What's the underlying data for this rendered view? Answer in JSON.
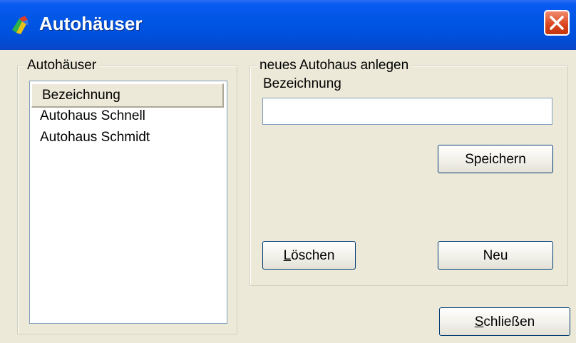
{
  "window": {
    "title": "Autohäuser"
  },
  "left_group": {
    "legend": "Autohäuser",
    "list": {
      "header": "Bezeichnung",
      "rows": [
        "Autohaus Schnell",
        "Autohaus Schmidt"
      ]
    }
  },
  "right_group": {
    "legend": "neues Autohaus anlegen",
    "field_label": "Bezeichnung",
    "field_value": "",
    "save_label": "Speichern",
    "delete_label": {
      "mnemonic": "L",
      "rest": "öschen"
    },
    "new_label": "Neu"
  },
  "footer": {
    "close_label": {
      "mnemonic": "S",
      "rest": "chließen"
    }
  },
  "icons": {
    "app": "app-icon",
    "close": "close-icon"
  },
  "colors": {
    "titlebar": "#0056e5",
    "close": "#d9441c",
    "face": "#ece9d8"
  }
}
